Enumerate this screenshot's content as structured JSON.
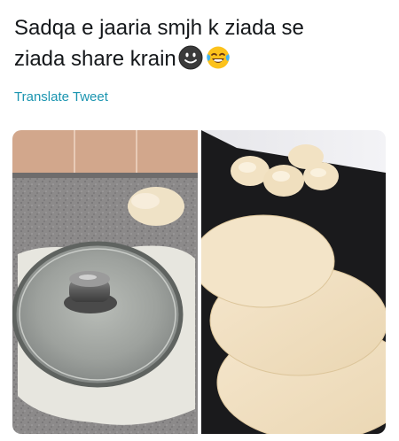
{
  "tweet": {
    "text_line1": "Sadqa e jaaria smjh k ziada se",
    "text_line2": "ziada share krain",
    "emojis": [
      "smiling-face-icon",
      "face-with-tears-of-joy-icon"
    ],
    "translate_label": "Translate Tweet"
  },
  "media": {
    "photos": [
      {
        "name": "dough-with-pot-lid",
        "description_icon": "pot-lid-icon"
      },
      {
        "name": "rolled-dough-sheets",
        "description_icon": "dough-balls-icon"
      }
    ]
  },
  "colors": {
    "text": "#14171a",
    "link": "#1b95b0",
    "background": "#ffffff"
  }
}
